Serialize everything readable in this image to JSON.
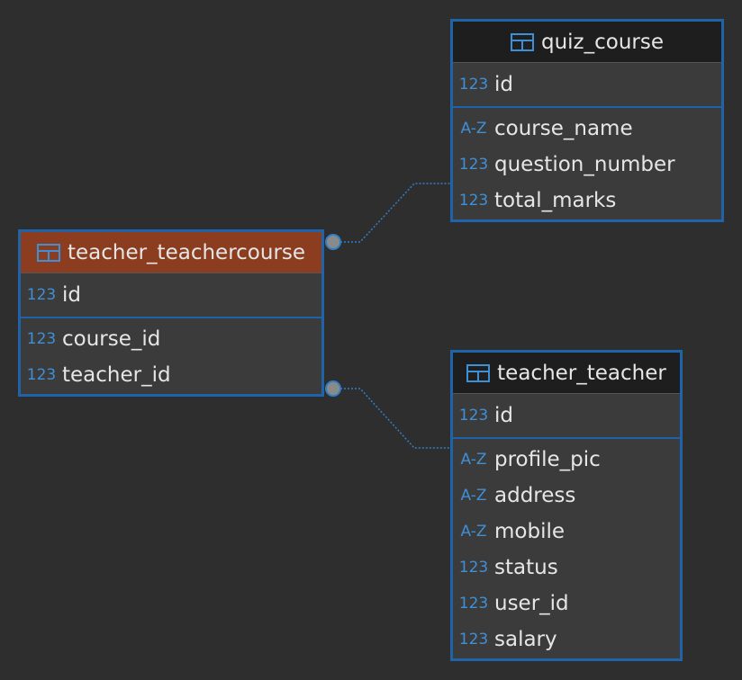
{
  "tables": {
    "teacher_teachercourse": {
      "name": "teacher_teachercourse",
      "highlighted": true,
      "pk": [
        {
          "type": "123",
          "name": "id"
        }
      ],
      "fields": [
        {
          "type": "123",
          "name": "course_id"
        },
        {
          "type": "123",
          "name": "teacher_id"
        }
      ]
    },
    "quiz_course": {
      "name": "quiz_course",
      "highlighted": false,
      "pk": [
        {
          "type": "123",
          "name": "id"
        }
      ],
      "fields": [
        {
          "type": "A-Z",
          "name": "course_name"
        },
        {
          "type": "123",
          "name": "question_number"
        },
        {
          "type": "123",
          "name": "total_marks"
        }
      ]
    },
    "teacher_teacher": {
      "name": "teacher_teacher",
      "highlighted": false,
      "pk": [
        {
          "type": "123",
          "name": "id"
        }
      ],
      "fields": [
        {
          "type": "A-Z",
          "name": "profile_pic"
        },
        {
          "type": "A-Z",
          "name": "address"
        },
        {
          "type": "A-Z",
          "name": "mobile"
        },
        {
          "type": "123",
          "name": "status"
        },
        {
          "type": "123",
          "name": "user_id"
        },
        {
          "type": "123",
          "name": "salary"
        }
      ]
    }
  },
  "relations": [
    {
      "from": "teacher_teachercourse",
      "to": "quiz_course"
    },
    {
      "from": "teacher_teachercourse",
      "to": "teacher_teacher"
    }
  ],
  "colors": {
    "border": "#1f64a8",
    "connector": "#2f7fc9",
    "highlight_header": "#8c3d1f",
    "type_icon": "#3e8fd6"
  }
}
